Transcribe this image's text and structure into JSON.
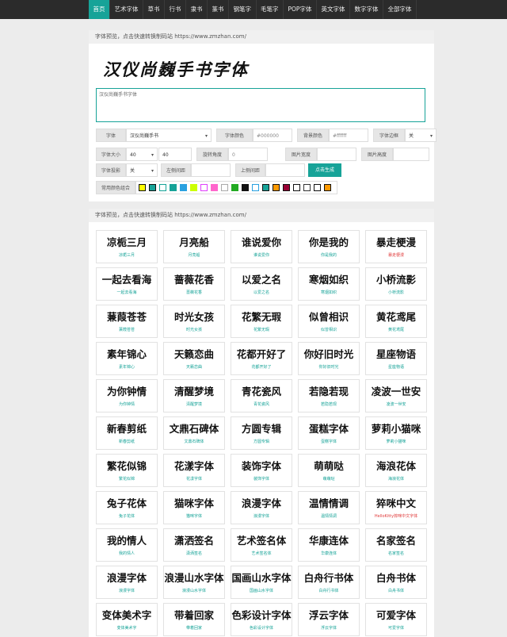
{
  "nav": {
    "items": [
      "首页",
      "艺术字体",
      "草书",
      "行书",
      "隶书",
      "篆书",
      "钢笔字",
      "毛笔字",
      "POP字体",
      "英文字体",
      "数字字体",
      "全部字体"
    ],
    "active_index": 0
  },
  "editor": {
    "header": "字体预览，点击快速转换制码站 https://www.zmzhan.com/",
    "preview_text": "汉仪尚巍手书字体",
    "textarea_value": "汉仪尚巍手书字体",
    "font_label": "字体",
    "font_value": "汉仪尚巍手书",
    "font_color_label": "字体颜色",
    "font_color_value": "#000000",
    "bg_color_label": "背景颜色",
    "bg_color_value": "#ffffff",
    "outline_label": "字体边框",
    "outline_value": "关",
    "size_label": "字体大小",
    "size_value": "40",
    "size_value2": "40",
    "rotate_label": "旋转角度",
    "rotate_value": "0",
    "img_width_label": "图片宽度",
    "img_height_label": "图片高度",
    "shadow_label": "字体投影",
    "shadow_value": "关",
    "left_spacing_label": "左侧间距",
    "top_spacing_label": "上侧间距",
    "generate_label": "点击生成",
    "common_colors_label": "常用颜色组合",
    "swatches": [
      {
        "fill": "#ffff00",
        "border": "#111111"
      },
      {
        "fill": "#17a398",
        "border": "#111111"
      },
      {
        "fill": "#ffffff",
        "border": "#17a398"
      },
      {
        "fill": "#17a398",
        "border": "#17a398"
      },
      {
        "fill": "#2aa1e0",
        "border": "#2aa1e0"
      },
      {
        "fill": "#ccff00",
        "border": "#ccff00"
      },
      {
        "fill": "#ffffff",
        "border": "#e040fb"
      },
      {
        "fill": "#ff66cc",
        "border": "#ff66cc"
      },
      {
        "fill": "#ffffff",
        "border": "#aaaaaa"
      },
      {
        "fill": "#22aa22",
        "border": "#22aa22"
      },
      {
        "fill": "#111111",
        "border": "#111111"
      },
      {
        "fill": "#ffffff",
        "border": "#2aa1e0"
      },
      {
        "fill": "#17a398",
        "border": "#111111"
      },
      {
        "fill": "#ff9900",
        "border": "#111111"
      },
      {
        "fill": "#990033",
        "border": "#111111"
      },
      {
        "fill": "#ffffff",
        "border": "#111111"
      },
      {
        "fill": "#ffffff",
        "border": "#333333"
      },
      {
        "fill": "#ffffff",
        "border": "#111111"
      },
      {
        "fill": "#ff9900",
        "border": "#111111"
      }
    ]
  },
  "gallery": {
    "header": "字体预览，点击快速转换制码站 https://www.zmzhan.com/",
    "fonts": [
      {
        "art": "凉栀三月",
        "caption": "凉栀三月"
      },
      {
        "art": "月亮船",
        "caption": "月亮船"
      },
      {
        "art": "谁说爱你",
        "caption": "谁说爱你"
      },
      {
        "art": "你是我的",
        "caption": "你是我的"
      },
      {
        "art": "暴走梗漫",
        "caption": "暴走梗漫",
        "red": true
      },
      {
        "art": "一起去看海",
        "caption": "一起去看海"
      },
      {
        "art": "蔷薇花香",
        "caption": "蔷薇花香"
      },
      {
        "art": "以爱之名",
        "caption": "以爱之名"
      },
      {
        "art": "寒烟如织",
        "caption": "寒烟如织"
      },
      {
        "art": "小桥流影",
        "caption": "小桥流影"
      },
      {
        "art": "蒹葭苍苍",
        "caption": "蒹葭苍苍"
      },
      {
        "art": "时光女孩",
        "caption": "时光女孩"
      },
      {
        "art": "花繁无瑕",
        "caption": "花繁无瑕"
      },
      {
        "art": "似曾相识",
        "caption": "似曾相识"
      },
      {
        "art": "黄花鸢尾",
        "caption": "黄花鸢尾"
      },
      {
        "art": "素年锦心",
        "caption": "素年锦心"
      },
      {
        "art": "天籁恋曲",
        "caption": "天籁恋曲"
      },
      {
        "art": "花都开好了",
        "caption": "花都开好了"
      },
      {
        "art": "你好旧时光",
        "caption": "你好旧时光"
      },
      {
        "art": "星座物语",
        "caption": "星座物语"
      },
      {
        "art": "为你钟情",
        "caption": "为你钟情"
      },
      {
        "art": "清醒梦境",
        "caption": "清醒梦境"
      },
      {
        "art": "青花瓷风",
        "caption": "青花瓷风"
      },
      {
        "art": "若隐若现",
        "caption": "若隐若现"
      },
      {
        "art": "凌波一世安",
        "caption": "凌波一世安"
      },
      {
        "art": "新春剪纸",
        "caption": "新春剪纸"
      },
      {
        "art": "文鼎石碑体",
        "caption": "文鼎石碑体"
      },
      {
        "art": "方圆专辑",
        "caption": "方圆专辑"
      },
      {
        "art": "蛋糕字体",
        "caption": "蛋糕字体"
      },
      {
        "art": "萝莉小猫咪",
        "caption": "萝莉小猫咪"
      },
      {
        "art": "繁花似锦",
        "caption": "繁花似锦"
      },
      {
        "art": "花漾字体",
        "caption": "花漾字体"
      },
      {
        "art": "装饰字体",
        "caption": "装饰字体"
      },
      {
        "art": "萌萌哒",
        "caption": "萌萌哒"
      },
      {
        "art": "海浪花体",
        "caption": "海浪花体"
      },
      {
        "art": "兔子花体",
        "caption": "兔子花体"
      },
      {
        "art": "猫咪字体",
        "caption": "猫咪字体"
      },
      {
        "art": "浪漫字体",
        "caption": "浪漫字体"
      },
      {
        "art": "温情情调",
        "caption": "温情情调"
      },
      {
        "art": "猝咪中文",
        "caption": "HelloKitty猝咪中文字体",
        "red": true
      },
      {
        "art": "我的情人",
        "caption": "我的情人"
      },
      {
        "art": "潇洒签名",
        "caption": "潇洒签名"
      },
      {
        "art": "艺术签名体",
        "caption": "艺术签名体"
      },
      {
        "art": "华康连体",
        "caption": "华康连体"
      },
      {
        "art": "名家签名",
        "caption": "名家签名"
      },
      {
        "art": "浪漫字体",
        "caption": "浪漫字体"
      },
      {
        "art": "浪漫山水字体",
        "caption": "浪漫山水字体"
      },
      {
        "art": "国画山水字体",
        "caption": "国画山水字体"
      },
      {
        "art": "白舟行书体",
        "caption": "白舟行书体"
      },
      {
        "art": "白舟书体",
        "caption": "白舟书体"
      },
      {
        "art": "变体美术字",
        "caption": "变体美术字"
      },
      {
        "art": "带着回家",
        "caption": "带着回家"
      },
      {
        "art": "色彩设计字体",
        "caption": "色彩设计字体"
      },
      {
        "art": "浮云字体",
        "caption": "浮云字体"
      },
      {
        "art": "可爱字体",
        "caption": "可爱字体"
      }
    ]
  }
}
